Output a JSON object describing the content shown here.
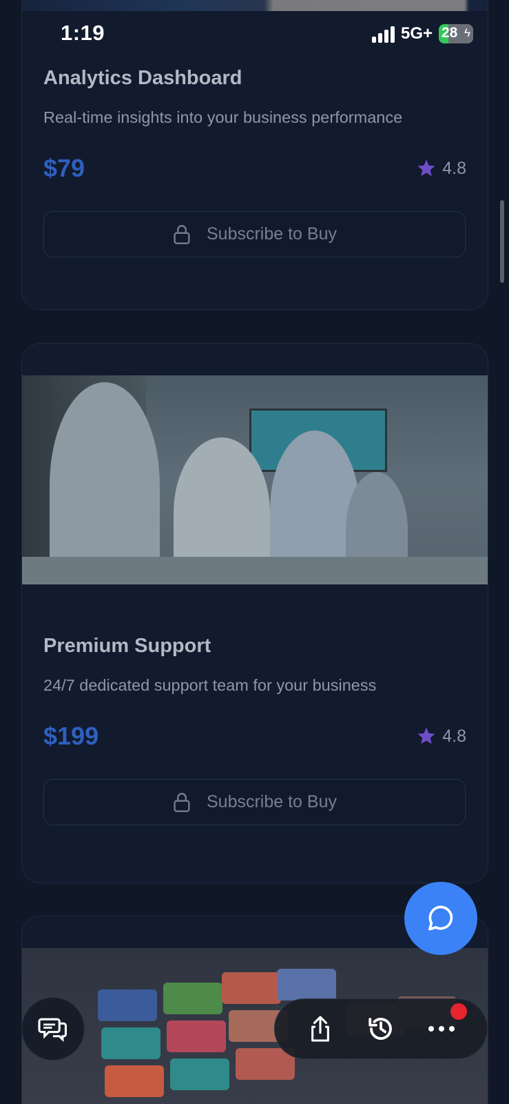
{
  "status_bar": {
    "time": "1:19",
    "network": "5G+",
    "battery_level": "28",
    "battery_level_fraction": 0.28
  },
  "products": [
    {
      "title": "Analytics Dashboard",
      "description": "Real-time insights into your business performance",
      "price": "$79",
      "rating": "4.8",
      "button_label": "Subscribe to Buy"
    },
    {
      "title": "Premium Support",
      "description": "24/7 dedicated support team for your business",
      "price": "$199",
      "rating": "4.8",
      "button_label": "Subscribe to Buy"
    }
  ],
  "colors": {
    "background": "#101828",
    "card": "#121a2d",
    "price": "#2f5fbf",
    "star": "#6d4ec9",
    "fab": "#3b82f6",
    "notification": "#e5242f"
  },
  "icons": {
    "lock": "lock-icon",
    "star": "star-icon",
    "chat": "chat-bubble-icon",
    "comments": "comments-icon",
    "share": "share-icon",
    "history": "history-icon",
    "more": "more-dots-icon"
  }
}
